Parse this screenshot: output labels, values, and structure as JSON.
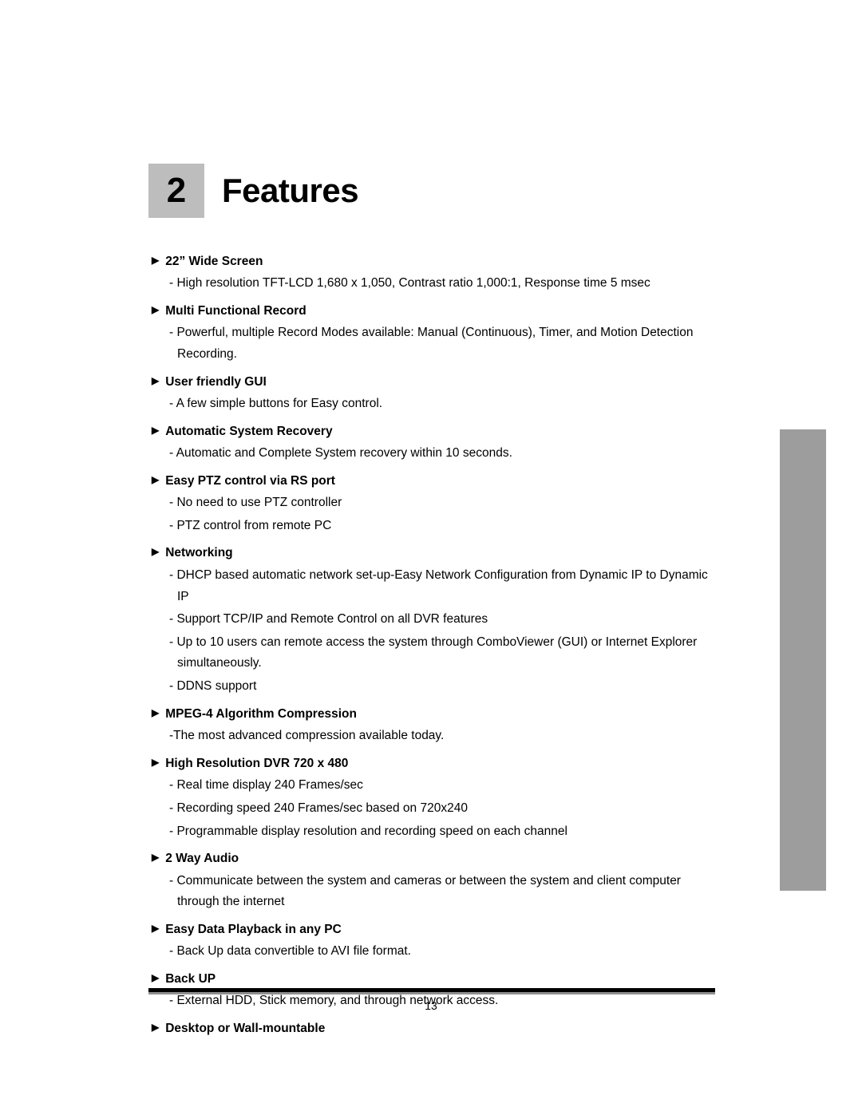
{
  "chapter": {
    "number": "2",
    "title": "Features"
  },
  "features": [
    {
      "heading": "22” Wide Screen",
      "lines": [
        "- High resolution TFT-LCD 1,680 x 1,050, Contrast ratio 1,000:1, Response time 5 msec"
      ]
    },
    {
      "heading": "Multi Functional Record",
      "lines": [
        "- Powerful, multiple Record Modes available: Manual (Continuous), Timer, and Motion Detection Recording."
      ]
    },
    {
      "heading": "User friendly GUI",
      "lines": [
        "- A few simple buttons for Easy control."
      ]
    },
    {
      "heading": "Automatic System Recovery",
      "lines": [
        "- Automatic and Complete System recovery within 10 seconds."
      ]
    },
    {
      "heading": "Easy PTZ control via RS port",
      "lines": [
        "- No need to use PTZ controller",
        "- PTZ control from remote PC"
      ]
    },
    {
      "heading": "Networking",
      "lines": [
        "- DHCP based automatic network set-up-Easy Network Configuration from Dynamic IP to Dynamic IP",
        "- Support TCP/IP and Remote Control on all DVR features",
        "- Up to 10 users can remote access the system through ComboViewer (GUI) or Internet Explorer simultaneously.",
        "- DDNS support"
      ]
    },
    {
      "heading": "MPEG-4 Algorithm Compression",
      "lines": [
        "-The most advanced compression available today."
      ]
    },
    {
      "heading": "High Resolution DVR 720 x 480",
      "lines": [
        "- Real time display 240 Frames/sec",
        "- Recording speed 240 Frames/sec based on 720x240",
        "- Programmable display resolution and recording speed on each channel"
      ]
    },
    {
      "heading": "2 Way Audio",
      "lines": [
        "- Communicate between the system and cameras or between the system and client computer through the internet"
      ]
    },
    {
      "heading": "Easy Data Playback in any PC",
      "lines": [
        "- Back Up data convertible to AVI file format."
      ]
    },
    {
      "heading": "Back UP",
      "lines": [
        "- External HDD, Stick memory, and through network access."
      ]
    },
    {
      "heading": "Desktop or Wall-mountable",
      "lines": []
    }
  ],
  "footer": {
    "page_number": "13"
  },
  "icons": {
    "bullet": "▶"
  }
}
